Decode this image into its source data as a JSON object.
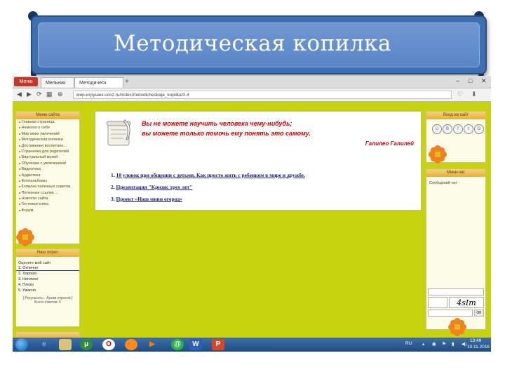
{
  "banner": {
    "title": "Методическая копилка"
  },
  "browser": {
    "menu_label": "Меню",
    "tabs": [
      "Мельник",
      "Методическ"
    ],
    "url": "мир-игрушек.ucoz.ru/index/metodicheskaja_kopilka/0-4"
  },
  "left_menu": {
    "header": "Меню сайта",
    "items": [
      "Главная страница",
      "Немного о себе",
      "Мир моих увлечений",
      "Методическая копилка",
      "Достижения воспитанн...",
      "Страничка для родителей",
      "Виртуальный музей",
      "Обучение с увлечением!",
      "Видеотека",
      "Аудиотека",
      "Фотоальбомы",
      "Копилка полезных советов",
      "Полезные ссылки ...",
      "Новости сайта",
      "Гостевая книга",
      "Форум"
    ]
  },
  "poll": {
    "header": "Наш опрос",
    "question": "Оцените мой сайт",
    "options": [
      "1. Отлично",
      "2. Хорошо",
      "3. Неплохо",
      "4. Плохо",
      "5. Ужасно"
    ],
    "results_link": "[ Результаты · Архив опросов ]",
    "total": "Всего ответов: 5"
  },
  "content": {
    "quote_line1": "Вы не можете научить человека чему-нибудь;",
    "quote_line2": "вы можете только помочь ему понять это самому.",
    "author": "Галилео Галилей",
    "links": [
      {
        "num": "1.",
        "text": "10 уловок при общении с детьми. Как просто жить с ребенком в мире и дружбе."
      },
      {
        "num": "2.",
        "text": "Презентация \"Кризис трех лет\""
      },
      {
        "num": "3.",
        "text": "Проект «Наш мини огород»"
      }
    ]
  },
  "right_panels": {
    "login_header": "Вход на сайт",
    "social": [
      "U",
      "В",
      "f",
      "t",
      "G"
    ],
    "chat_header": "Мини-чат",
    "chat_empty": "Сообщений нет",
    "captcha": "4sIm",
    "ok_label": "OK"
  },
  "taskbar": {
    "lang": "RU",
    "time": "13:49",
    "date": "10.11.2016"
  }
}
